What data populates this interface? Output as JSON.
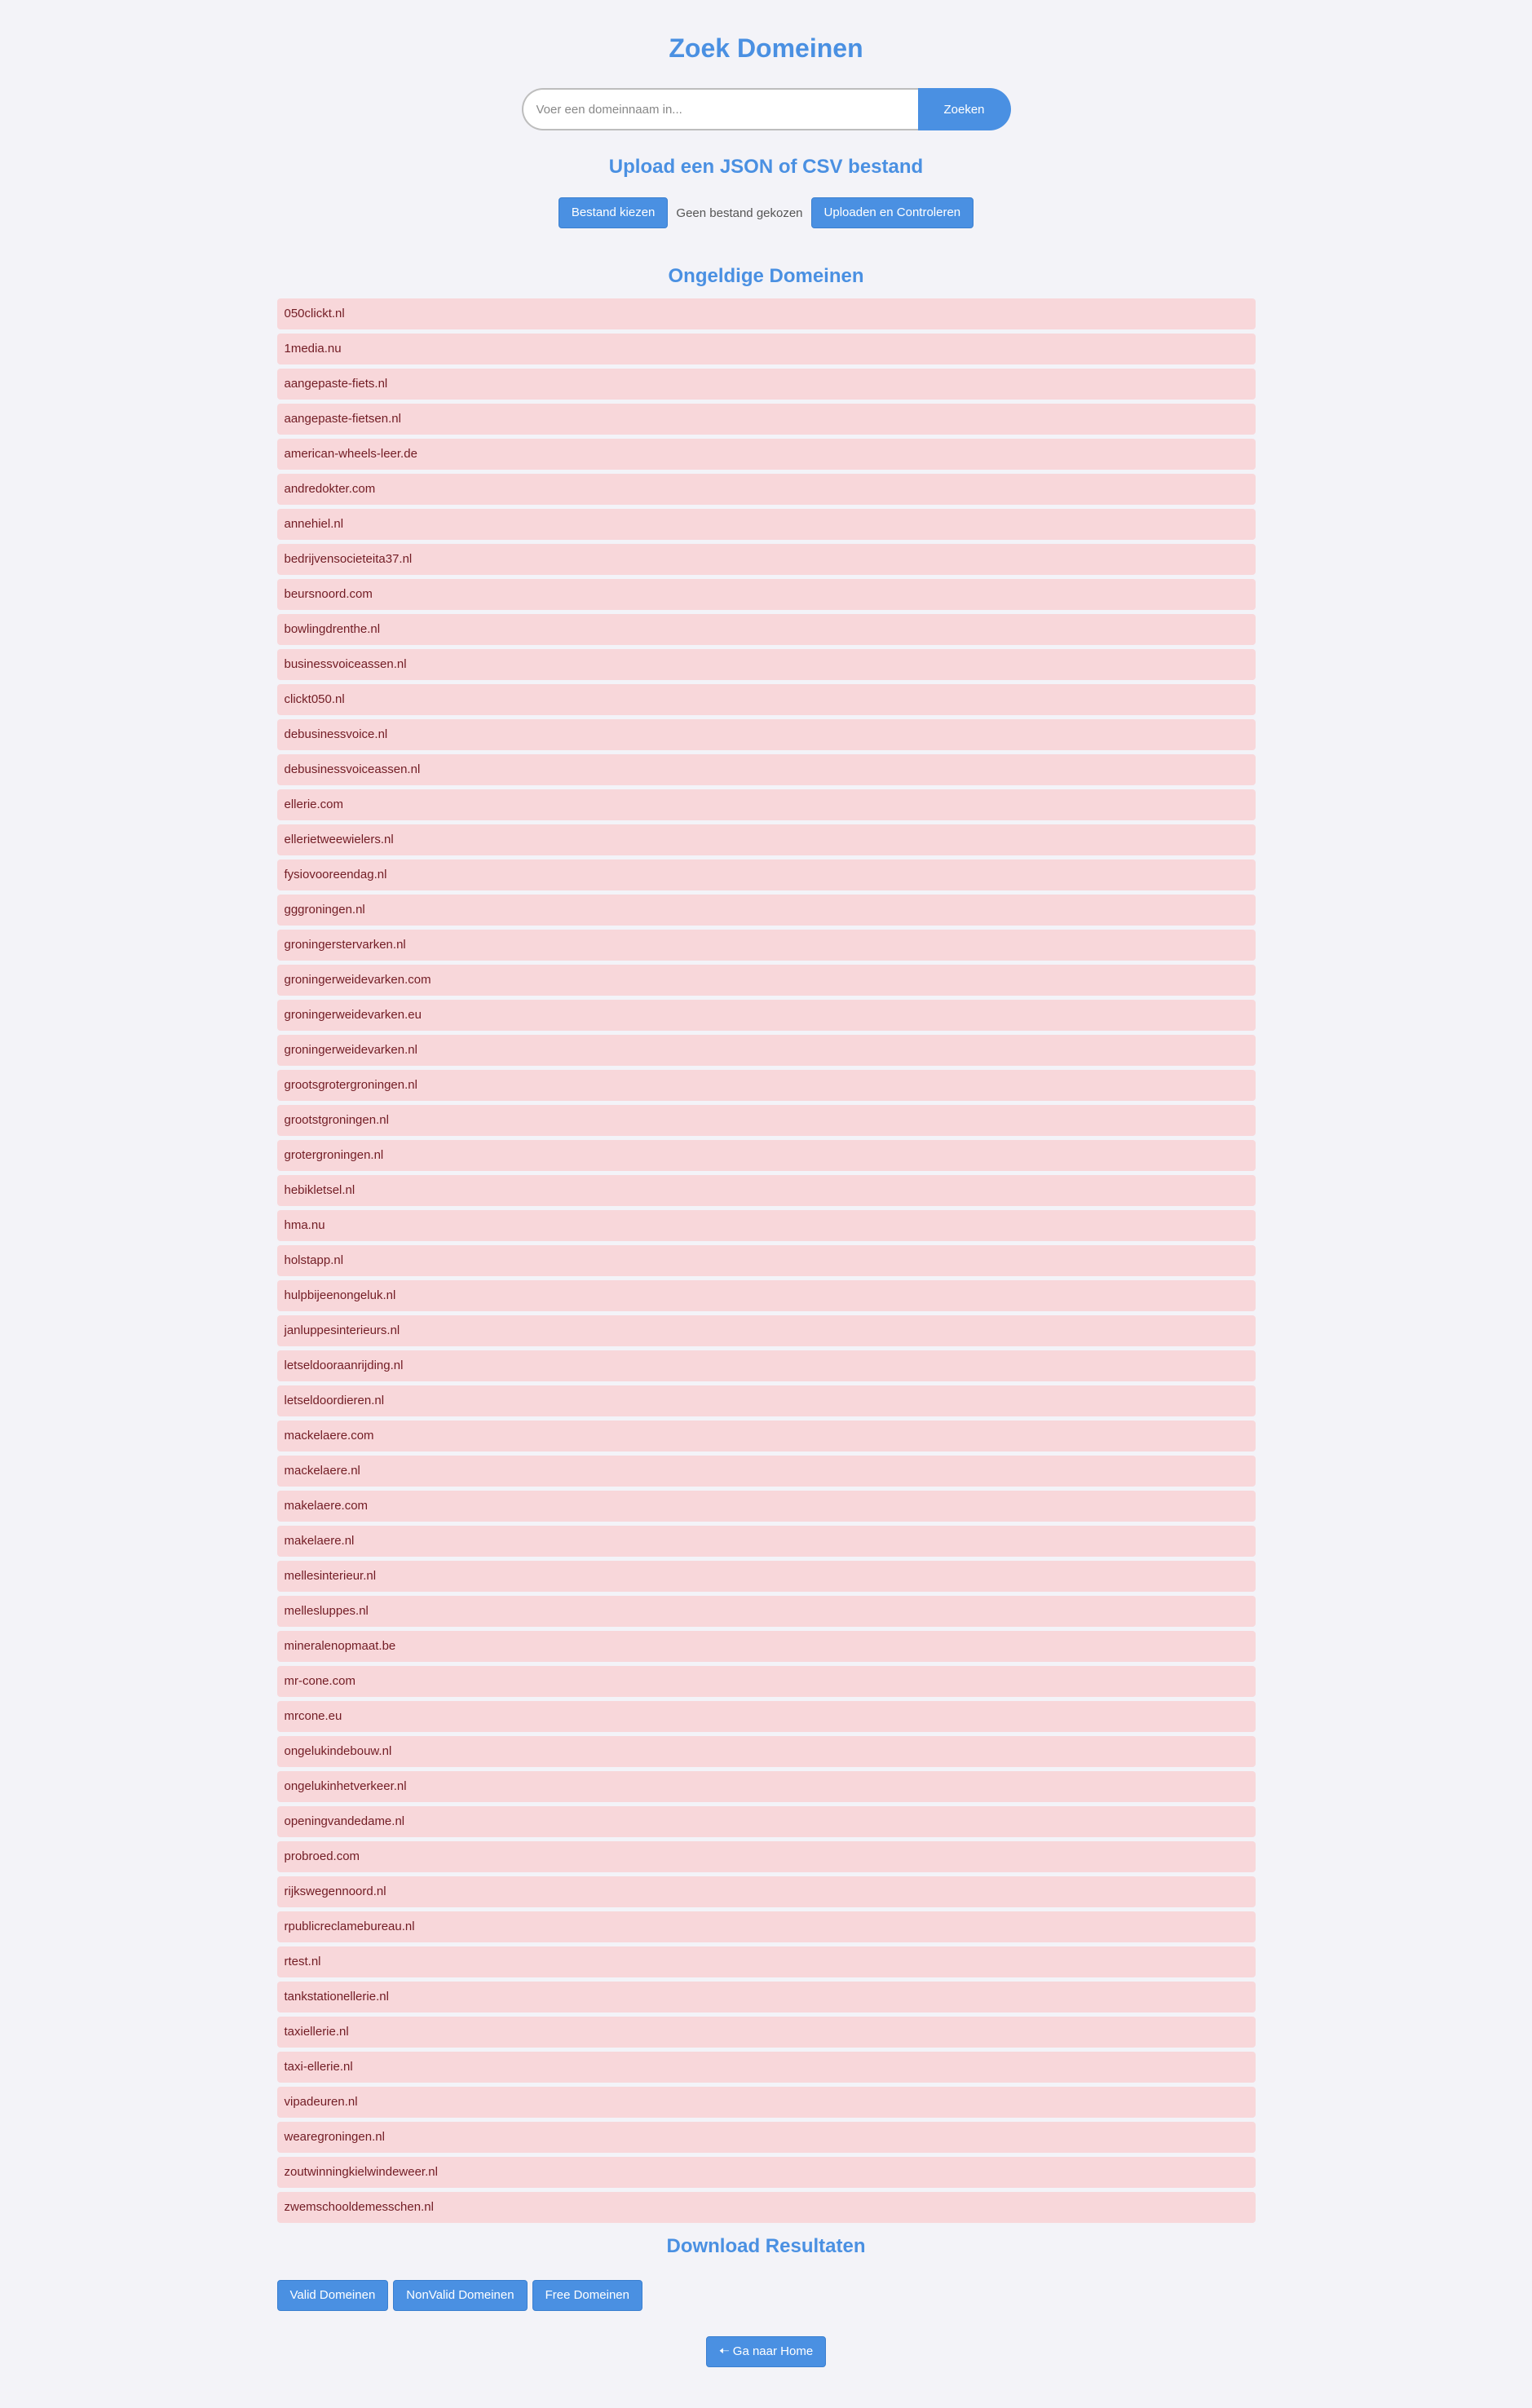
{
  "header": {
    "title": "Zoek Domeinen"
  },
  "search": {
    "placeholder": "Voer een domeinnaam in...",
    "value": "",
    "button_label": "Zoeken"
  },
  "upload": {
    "title": "Upload een JSON of CSV bestand",
    "choose_file_label": "Bestand kiezen",
    "file_status": "Geen bestand gekozen",
    "submit_label": "Uploaden en Controleren"
  },
  "invalid": {
    "title": "Ongeldige Domeinen",
    "domains": [
      "050clickt.nl",
      "1media.nu",
      "aangepaste-fiets.nl",
      "aangepaste-fietsen.nl",
      "american-wheels-leer.de",
      "andredokter.com",
      "annehiel.nl",
      "bedrijvensocieteita37.nl",
      "beursnoord.com",
      "bowlingdrenthe.nl",
      "businessvoiceassen.nl",
      "clickt050.nl",
      "debusinessvoice.nl",
      "debusinessvoiceassen.nl",
      "ellerie.com",
      "ellerietweewielers.nl",
      "fysiovooreendag.nl",
      "gggroningen.nl",
      "groningerstervarken.nl",
      "groningerweidevarken.com",
      "groningerweidevarken.eu",
      "groningerweidevarken.nl",
      "grootsgrotergroningen.nl",
      "grootstgroningen.nl",
      "grotergroningen.nl",
      "hebikletsel.nl",
      "hma.nu",
      "holstapp.nl",
      "hulpbijeenongeluk.nl",
      "janluppesinterieurs.nl",
      "letseldooraanrijding.nl",
      "letseldoordieren.nl",
      "mackelaere.com",
      "mackelaere.nl",
      "makelaere.com",
      "makelaere.nl",
      "mellesinterieur.nl",
      "mellesluppes.nl",
      "mineralenopmaat.be",
      "mr-cone.com",
      "mrcone.eu",
      "ongelukindebouw.nl",
      "ongelukinhetverkeer.nl",
      "openingvandedame.nl",
      "probroed.com",
      "rijkswegennoord.nl",
      "rpublicreclamebureau.nl",
      "rtest.nl",
      "tankstationellerie.nl",
      "taxiellerie.nl",
      "taxi-ellerie.nl",
      "vipadeuren.nl",
      "wearegroningen.nl",
      "zoutwinningkielwindeweer.nl",
      "zwemschooldemesschen.nl"
    ]
  },
  "download": {
    "title": "Download Resultaten",
    "buttons": [
      "Valid Domeinen",
      "NonValid Domeinen",
      "Free Domeinen"
    ]
  },
  "home": {
    "label": "🠠 Ga naar Home",
    "icon": "arrow-left-icon"
  },
  "colors": {
    "accent": "#4a90e2",
    "invalid_bg": "#f8d7da",
    "invalid_text": "#721c24",
    "page_bg": "#f3f3f8"
  }
}
